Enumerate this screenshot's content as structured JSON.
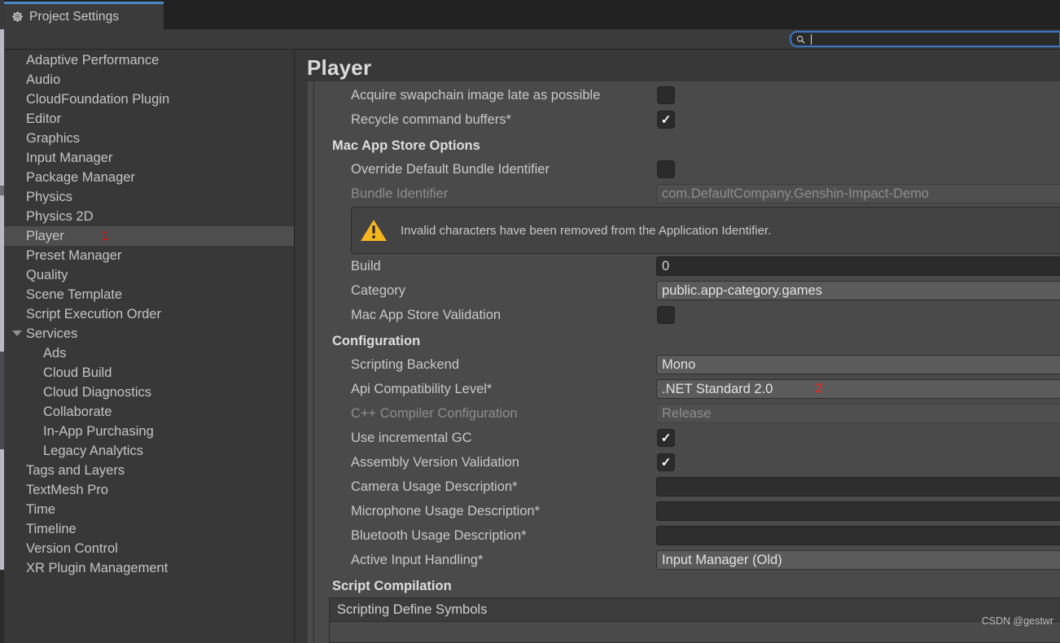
{
  "window": {
    "tab_label": "Project Settings",
    "tab_icon": "gear-icon"
  },
  "toolbar": {
    "search_value": "",
    "search_placeholder": "",
    "search_icon": "search-icon"
  },
  "sidebar": {
    "items": [
      {
        "label": "Adaptive Performance",
        "indent": false,
        "selected": false,
        "expander": false
      },
      {
        "label": "Audio",
        "indent": false,
        "selected": false,
        "expander": false
      },
      {
        "label": "CloudFoundation Plugin",
        "indent": false,
        "selected": false,
        "expander": false
      },
      {
        "label": "Editor",
        "indent": false,
        "selected": false,
        "expander": false
      },
      {
        "label": "Graphics",
        "indent": false,
        "selected": false,
        "expander": false
      },
      {
        "label": "Input Manager",
        "indent": false,
        "selected": false,
        "expander": false
      },
      {
        "label": "Package Manager",
        "indent": false,
        "selected": false,
        "expander": false
      },
      {
        "label": "Physics",
        "indent": false,
        "selected": false,
        "expander": false
      },
      {
        "label": "Physics 2D",
        "indent": false,
        "selected": false,
        "expander": false
      },
      {
        "label": "Player",
        "indent": false,
        "selected": true,
        "expander": false,
        "annotation": "1"
      },
      {
        "label": "Preset Manager",
        "indent": false,
        "selected": false,
        "expander": false
      },
      {
        "label": "Quality",
        "indent": false,
        "selected": false,
        "expander": false
      },
      {
        "label": "Scene Template",
        "indent": false,
        "selected": false,
        "expander": false
      },
      {
        "label": "Script Execution Order",
        "indent": false,
        "selected": false,
        "expander": false
      },
      {
        "label": "Services",
        "indent": false,
        "selected": false,
        "expander": true
      },
      {
        "label": "Ads",
        "indent": true,
        "selected": false,
        "expander": false
      },
      {
        "label": "Cloud Build",
        "indent": true,
        "selected": false,
        "expander": false
      },
      {
        "label": "Cloud Diagnostics",
        "indent": true,
        "selected": false,
        "expander": false
      },
      {
        "label": "Collaborate",
        "indent": true,
        "selected": false,
        "expander": false
      },
      {
        "label": "In-App Purchasing",
        "indent": true,
        "selected": false,
        "expander": false
      },
      {
        "label": "Legacy Analytics",
        "indent": true,
        "selected": false,
        "expander": false
      },
      {
        "label": "Tags and Layers",
        "indent": false,
        "selected": false,
        "expander": false
      },
      {
        "label": "TextMesh Pro",
        "indent": false,
        "selected": false,
        "expander": false
      },
      {
        "label": "Time",
        "indent": false,
        "selected": false,
        "expander": false
      },
      {
        "label": "Timeline",
        "indent": false,
        "selected": false,
        "expander": false
      },
      {
        "label": "Version Control",
        "indent": false,
        "selected": false,
        "expander": false
      },
      {
        "label": "XR Plugin Management",
        "indent": false,
        "selected": false,
        "expander": false
      }
    ]
  },
  "main": {
    "page_title": "Player",
    "rows_top": [
      {
        "label": "Acquire swapchain image late as possible",
        "type": "checkbox",
        "value": false,
        "clip": true
      },
      {
        "label": "Recycle command buffers*",
        "type": "checkbox",
        "value": true
      }
    ],
    "mac_app_store": {
      "heading": "Mac App Store Options",
      "rows": [
        {
          "label": "Override Default Bundle Identifier",
          "type": "checkbox",
          "value": false
        },
        {
          "label": "Bundle Identifier",
          "type": "text",
          "value": "com.DefaultCompany.Genshin-Impact-Demo",
          "dim": true
        }
      ],
      "warning": {
        "icon": "warning-triangle-icon",
        "text": "Invalid characters have been removed from the Application Identifier."
      },
      "rows_after": [
        {
          "label": "Build",
          "type": "text",
          "value": "0"
        },
        {
          "label": "Category",
          "type": "dropdown",
          "value": "public.app-category.games"
        },
        {
          "label": "Mac App Store Validation",
          "type": "checkbox",
          "value": false
        }
      ]
    },
    "configuration": {
      "heading": "Configuration",
      "rows": [
        {
          "label": "Scripting Backend",
          "type": "dropdown",
          "value": "Mono"
        },
        {
          "label": "Api Compatibility Level*",
          "type": "dropdown",
          "value": ".NET Standard 2.0",
          "annotation": "2"
        },
        {
          "label": "C++ Compiler Configuration",
          "type": "dropdown",
          "value": "Release",
          "disabled": true,
          "dim": true
        },
        {
          "label": "Use incremental GC",
          "type": "checkbox",
          "value": true
        },
        {
          "label": "Assembly Version Validation",
          "type": "checkbox",
          "value": true
        },
        {
          "label": "Camera Usage Description*",
          "type": "text",
          "value": ""
        },
        {
          "label": "Microphone Usage Description*",
          "type": "text",
          "value": ""
        },
        {
          "label": "Bluetooth Usage Description*",
          "type": "text",
          "value": ""
        },
        {
          "label": "Active Input Handling*",
          "type": "dropdown",
          "value": "Input Manager (Old)"
        }
      ]
    },
    "script_compilation": {
      "heading": "Script Compilation",
      "define_symbols_label": "Scripting Define Symbols"
    }
  },
  "watermark": {
    "text": "CSDN @gestwr"
  },
  "colors": {
    "accent_blue": "#3a79c8",
    "warning_yellow": "#f5b51e",
    "annotation_red": "#ff0000",
    "panel_bg": "#4a4a4a",
    "sidebar_bg": "#383838",
    "selected_row": "#4e4e4e"
  }
}
